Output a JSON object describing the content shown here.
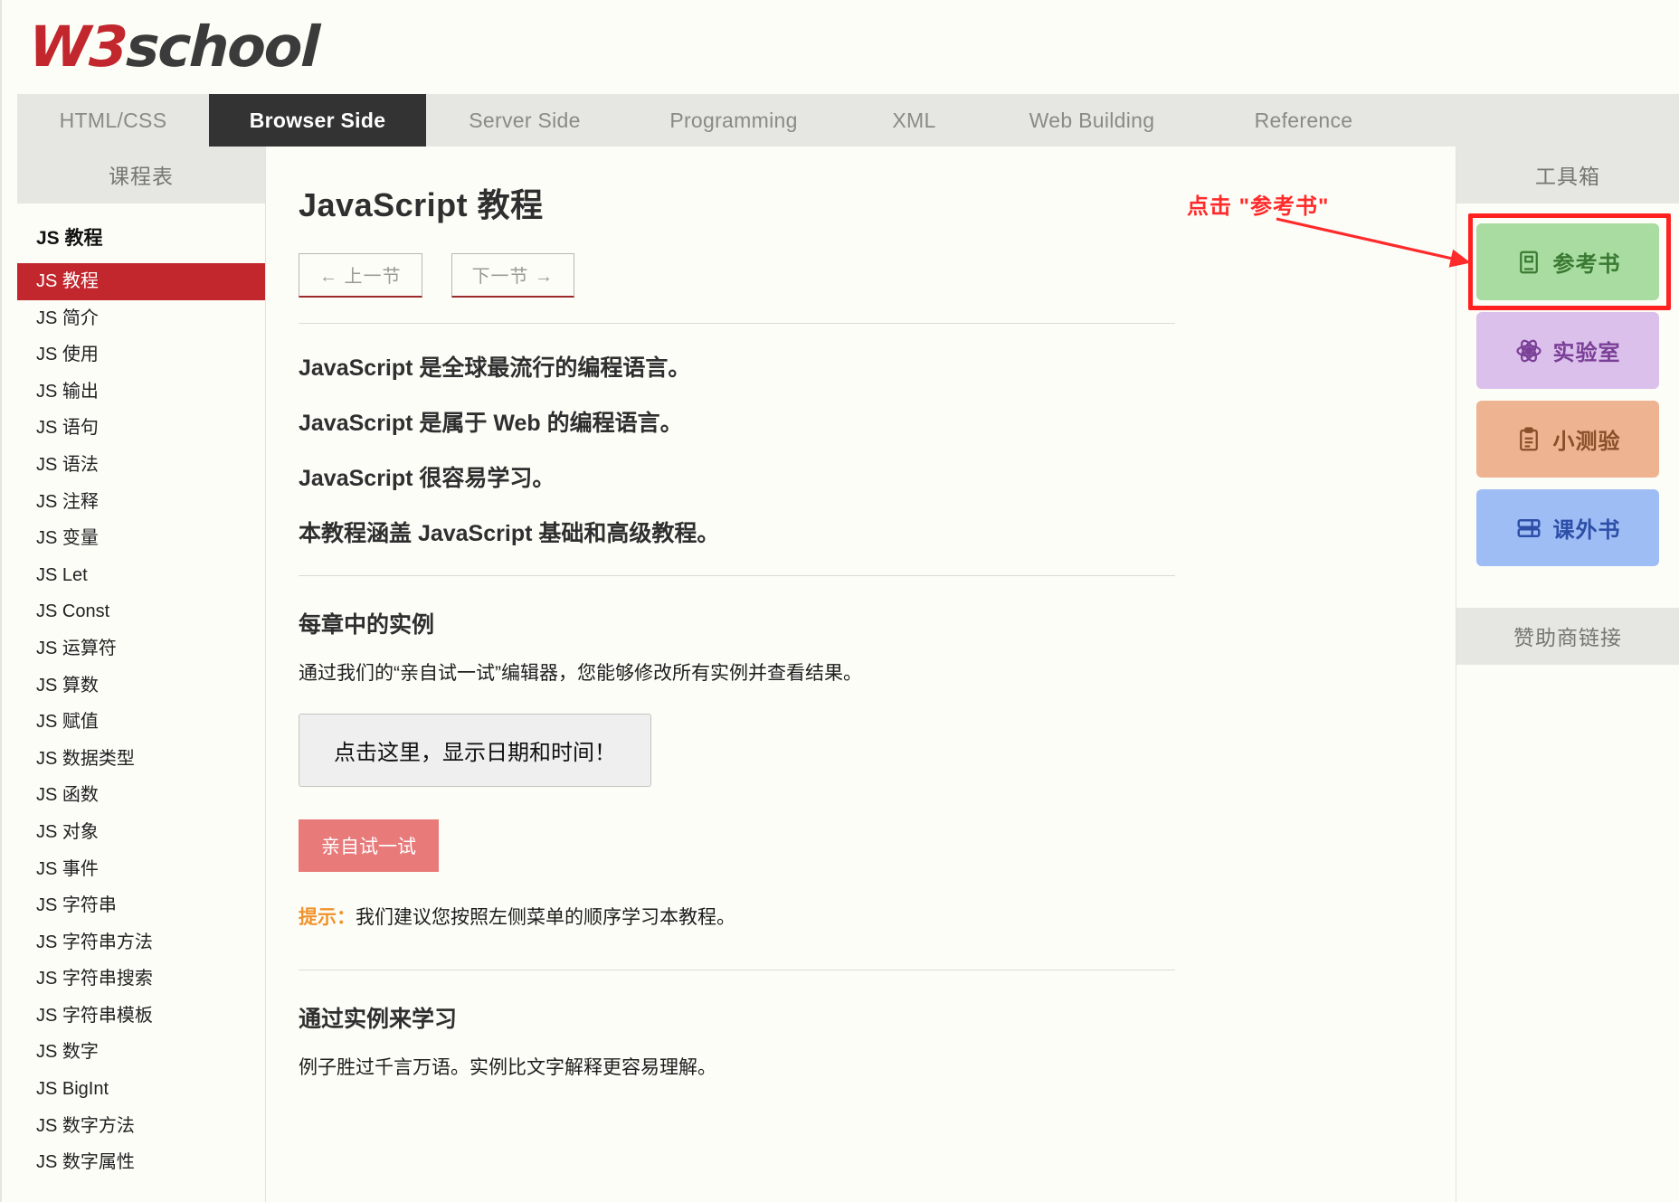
{
  "brand": {
    "prefix": "W3",
    "suffix": "school"
  },
  "topnav": {
    "items": [
      {
        "label": "HTML/CSS",
        "active": false
      },
      {
        "label": "Browser Side",
        "active": true
      },
      {
        "label": "Server Side",
        "active": false
      },
      {
        "label": "Programming",
        "active": false
      },
      {
        "label": "XML",
        "active": false
      },
      {
        "label": "Web Building",
        "active": false
      },
      {
        "label": "Reference",
        "active": false
      }
    ]
  },
  "sidebar": {
    "header": "课程表",
    "section_title": "JS 教程",
    "items": [
      {
        "label": "JS 教程",
        "active": true
      },
      {
        "label": "JS 简介",
        "active": false
      },
      {
        "label": "JS 使用",
        "active": false
      },
      {
        "label": "JS 输出",
        "active": false
      },
      {
        "label": "JS 语句",
        "active": false
      },
      {
        "label": "JS 语法",
        "active": false
      },
      {
        "label": "JS 注释",
        "active": false
      },
      {
        "label": "JS 变量",
        "active": false
      },
      {
        "label": "JS Let",
        "active": false
      },
      {
        "label": "JS Const",
        "active": false
      },
      {
        "label": "JS 运算符",
        "active": false
      },
      {
        "label": "JS 算数",
        "active": false
      },
      {
        "label": "JS 赋值",
        "active": false
      },
      {
        "label": "JS 数据类型",
        "active": false
      },
      {
        "label": "JS 函数",
        "active": false
      },
      {
        "label": "JS 对象",
        "active": false
      },
      {
        "label": "JS 事件",
        "active": false
      },
      {
        "label": "JS 字符串",
        "active": false
      },
      {
        "label": "JS 字符串方法",
        "active": false
      },
      {
        "label": "JS 字符串搜索",
        "active": false
      },
      {
        "label": "JS 字符串模板",
        "active": false
      },
      {
        "label": "JS 数字",
        "active": false
      },
      {
        "label": "JS BigInt",
        "active": false
      },
      {
        "label": "JS 数字方法",
        "active": false
      },
      {
        "label": "JS 数字属性",
        "active": false
      }
    ]
  },
  "main": {
    "title": "JavaScript 教程",
    "prev_button": "← 上一节",
    "next_button": "下一节 →",
    "leads": [
      "JavaScript 是全球最流行的编程语言。",
      "JavaScript 是属于 Web 的编程语言。",
      "JavaScript 很容易学习。",
      "本教程涵盖 JavaScript 基础和高级教程。"
    ],
    "section1_title": "每章中的实例",
    "section1_body": "通过我们的“亲自试一试”编辑器，您能够修改所有实例并查看结果。",
    "demo_button": "点击这里，显示日期和时间！",
    "tryit_button": "亲自试一试",
    "tip_label": "提示：",
    "tip_text": "我们建议您按照左侧菜单的顺序学习本教程。",
    "section2_title": "通过实例来学习",
    "section2_body": "例子胜过千言万语。实例比文字解释更容易理解。"
  },
  "toolbox": {
    "header": "工具箱",
    "sponsor_header": "赞助商链接",
    "buttons": [
      {
        "label": "参考书",
        "icon": "book-icon",
        "bg": "#a8dca0",
        "fg": "#3a7a33",
        "highlighted": true
      },
      {
        "label": "实验室",
        "icon": "atom-icon",
        "bg": "#dcc0ec",
        "fg": "#7a3f96",
        "highlighted": false
      },
      {
        "label": "小测验",
        "icon": "clipboard-icon",
        "bg": "#eeb391",
        "fg": "#8a4f2a",
        "highlighted": false
      },
      {
        "label": "课外书",
        "icon": "bookshelf-icon",
        "bg": "#9fbdf5",
        "fg": "#2d4fa8",
        "highlighted": false
      }
    ]
  },
  "annotation": {
    "text": "点击 \"参考书\"",
    "color": "#ff2a2a"
  }
}
